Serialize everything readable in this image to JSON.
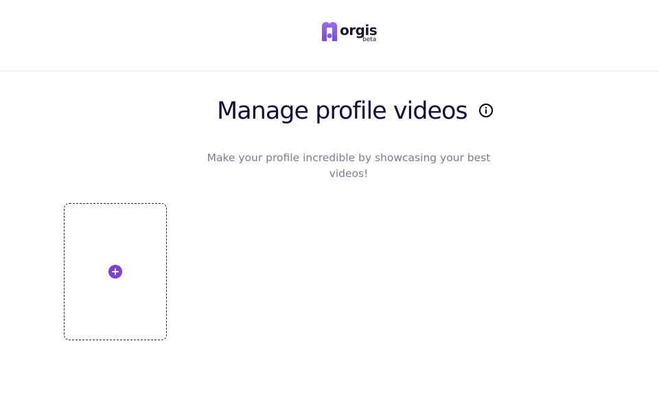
{
  "header": {
    "logo_text": "orgis",
    "logo_badge": "beta"
  },
  "main": {
    "title": "Manage profile videos",
    "subtitle": "Make your profile incredible by showcasing your best videos!",
    "info_icon": "info-icon",
    "upload_slot_icon": "plus-circle-icon"
  },
  "colors": {
    "brand_purple": "#8a5cf0",
    "title_navy": "#0d0c3b",
    "subtitle_gray": "#7b7a93",
    "add_icon_purple": "#7e3fd6"
  }
}
